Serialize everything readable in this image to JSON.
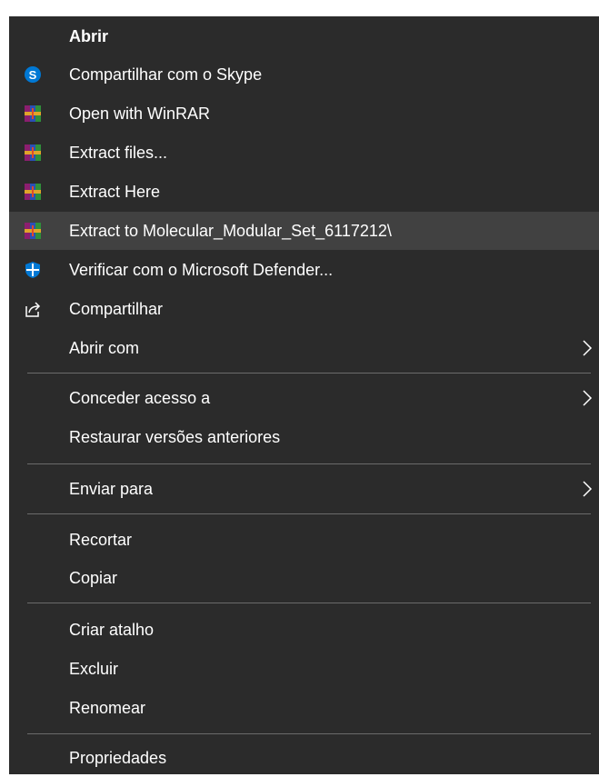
{
  "menu": {
    "items": [
      {
        "label": "Abrir",
        "icon": "none"
      },
      {
        "label": "Compartilhar com o Skype",
        "icon": "skype-icon"
      },
      {
        "label": "Open with WinRAR",
        "icon": "winrar-icon"
      },
      {
        "label": "Extract files...",
        "icon": "winrar-icon"
      },
      {
        "label": "Extract Here",
        "icon": "winrar-icon"
      },
      {
        "label": "Extract to Molecular_Modular_Set_6117212\\",
        "icon": "winrar-icon",
        "highlighted": true
      },
      {
        "label": "Verificar com o Microsoft Defender...",
        "icon": "defender-icon"
      },
      {
        "label": "Compartilhar",
        "icon": "share-icon"
      },
      {
        "label": "Abrir com",
        "icon": "none",
        "submenu": true
      },
      {
        "label": "Conceder acesso a",
        "icon": "none",
        "submenu": true
      },
      {
        "label": "Restaurar versões anteriores",
        "icon": "none"
      },
      {
        "label": "Enviar para",
        "icon": "none",
        "submenu": true
      },
      {
        "label": "Recortar",
        "icon": "none"
      },
      {
        "label": "Copiar",
        "icon": "none"
      },
      {
        "label": "Criar atalho",
        "icon": "none"
      },
      {
        "label": "Excluir",
        "icon": "none"
      },
      {
        "label": "Renomear",
        "icon": "none"
      },
      {
        "label": "Propriedades",
        "icon": "none"
      }
    ]
  },
  "colors": {
    "menu_bg": "#2b2b2b",
    "highlight_bg": "#414141",
    "separator": "#6b6b6b",
    "text": "#ffffff",
    "skype_blue": "#0078d4",
    "defender_blue": "#0078d4"
  }
}
